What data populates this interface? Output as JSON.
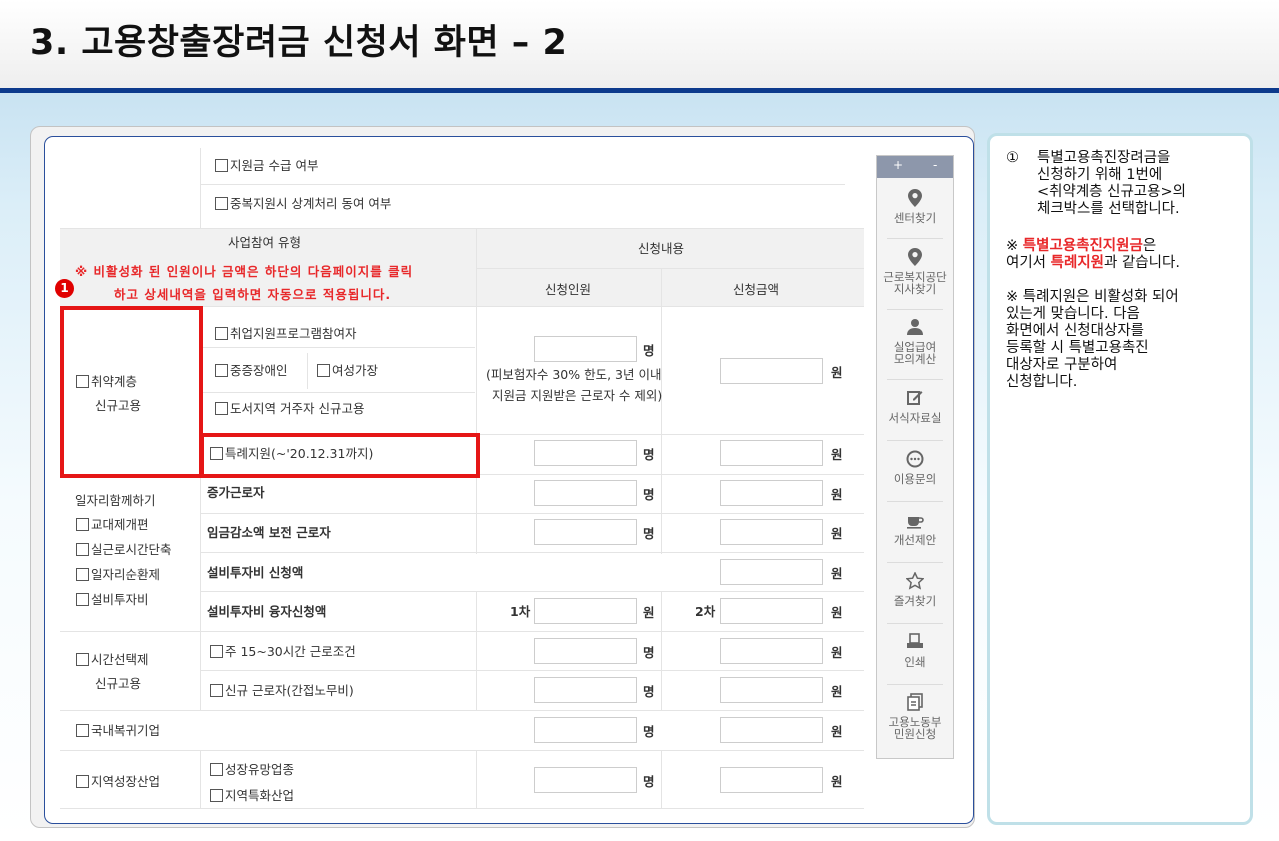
{
  "slide_title": "3. 고용창출장려금 신청서 화면 – 2",
  "top_options": {
    "funding_received": "지원금 수급 여부",
    "duplicate_consent": "중복지원시 상계처리 동여 여부"
  },
  "headers": {
    "participation_type": "사업참여 유형",
    "application_content": "신청내용",
    "applicants": "신청인원",
    "amount": "신청금액"
  },
  "red_notice": {
    "line1": "※ 비활성화 된 인원이나 금액은 하단의 다음페이지를 클릭",
    "line2": "하고 상세내역을 입력하면 자동으로 적용됩니다.",
    "marker": "1"
  },
  "vulnerable": {
    "label_line1": "취약계층",
    "label_line2": "신규고용",
    "options": {
      "employment_program": "취업지원프로그램참여자",
      "severe_disability": "중증장애인",
      "female_head": "여성가장",
      "island_region": "도서지역 거주자 신규고용"
    },
    "note_line1": "(피보험자수 30% 한도, 3년 이내",
    "note_line2": "지원금 지원받은 근로자 수 제외)",
    "special": "특례지원(~'20.12.31까지)"
  },
  "job_sharing": {
    "label": "일자리함께하기",
    "options": [
      "교대제개편",
      "실근로시간단축",
      "일자리순환제",
      "설비투자비"
    ],
    "rows": [
      "증가근로자",
      "임금감소액 보전 근로자",
      "설비투자비 신청액",
      "설비투자비 융자신청액"
    ],
    "first_round": "1차",
    "second_round": "2차"
  },
  "part_time": {
    "label_line1": "시간선택제",
    "label_line2": "신규고용",
    "options": [
      "주 15~30시간 근로조건",
      "신규 근로자(간접노무비)"
    ]
  },
  "reshoring": "국내복귀기업",
  "regional": {
    "label": "지역성장산업",
    "options": [
      "성장유망업종",
      "지역특화산업"
    ]
  },
  "units": {
    "person": "명",
    "won": "원"
  },
  "sidebar": {
    "plus": "+",
    "minus": "-",
    "items": [
      {
        "icon": "location-pin-icon",
        "label_line1": "센터찾기",
        "label_line2": ""
      },
      {
        "icon": "location-pin-icon",
        "label_line1": "근로복지공단",
        "label_line2": "지사찾기"
      },
      {
        "icon": "person-icon",
        "label_line1": "실업급여",
        "label_line2": "모의계산"
      },
      {
        "icon": "pencil-icon",
        "label_line1": "서식자료실",
        "label_line2": ""
      },
      {
        "icon": "chat-icon",
        "label_line1": "이용문의",
        "label_line2": ""
      },
      {
        "icon": "coffee-cup-icon",
        "label_line1": "개선제안",
        "label_line2": ""
      },
      {
        "icon": "star-icon",
        "label_line1": "즐겨찾기",
        "label_line2": ""
      },
      {
        "icon": "printer-icon",
        "label_line1": "인쇄",
        "label_line2": ""
      },
      {
        "icon": "copy-document-icon",
        "label_line1": "고용노동부",
        "label_line2": "민원신청"
      }
    ]
  },
  "notes": {
    "step_marker": "①",
    "step_line1": "특별고용촉진장려금을",
    "step_line2": "신청하기 위해 1번에",
    "step_line3": "<취약계층 신규고용>의",
    "step_line4": "체크박스를 선택합니다.",
    "ref_prefix": "※ ",
    "ref_red1": "특별고용촉진지원금",
    "ref_text1": "은",
    "ref_text2": "여기서 ",
    "ref_red2": "특례지원",
    "ref_text3": "과 같습니다.",
    "n2_line1": "※ 특례지원은 비활성화 되어",
    "n2_line2": "있는게 맞습니다. 다음",
    "n2_line3": "화면에서 신청대상자를",
    "n2_line4": "등록할 시 특별고용촉진",
    "n2_line5": "대상자로 구분하여",
    "n2_line6": "신청합니다."
  },
  "colors": {
    "title_underline": "#0c3a8c",
    "highlight_red": "#e51616",
    "notice_red": "#e8282a",
    "frame_blue": "#2a4f9c",
    "note_border": "#bfe0e8"
  }
}
